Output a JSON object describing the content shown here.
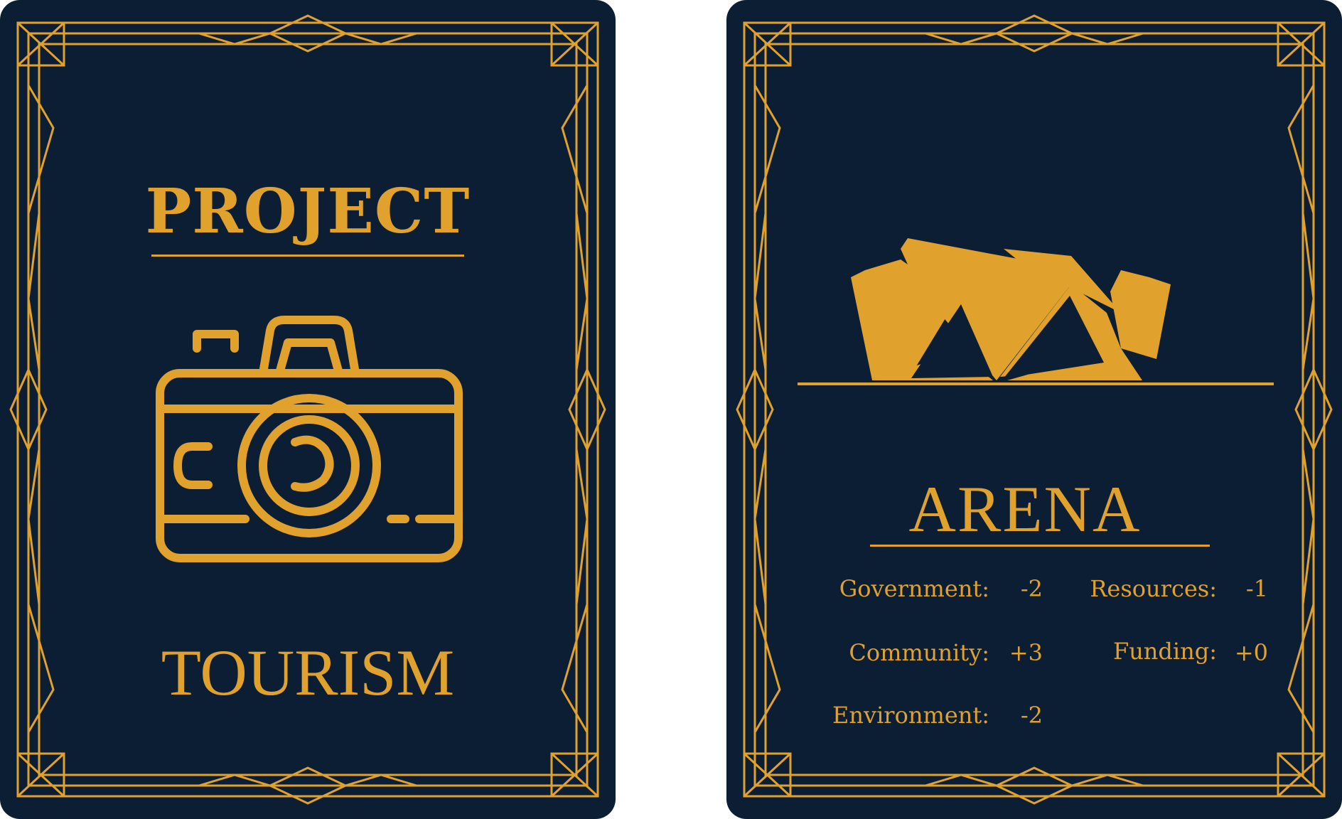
{
  "colors": {
    "card_bg": "#0c1e33",
    "gold": "#e0a12d"
  },
  "cards": {
    "back": {
      "title": "PROJECT",
      "icon": "camera-icon",
      "subtitle": "TOURISM"
    },
    "front": {
      "icon": "arena-stadium-icon",
      "title": "ARENA",
      "stats": [
        {
          "label": "Government:",
          "value": "-2"
        },
        {
          "label": "Resources:",
          "value": "-1"
        },
        {
          "label": "Community:",
          "value": "+3"
        },
        {
          "label": "Funding:",
          "value": "+0"
        },
        {
          "label": "Environment:",
          "value": "-2"
        }
      ]
    }
  }
}
